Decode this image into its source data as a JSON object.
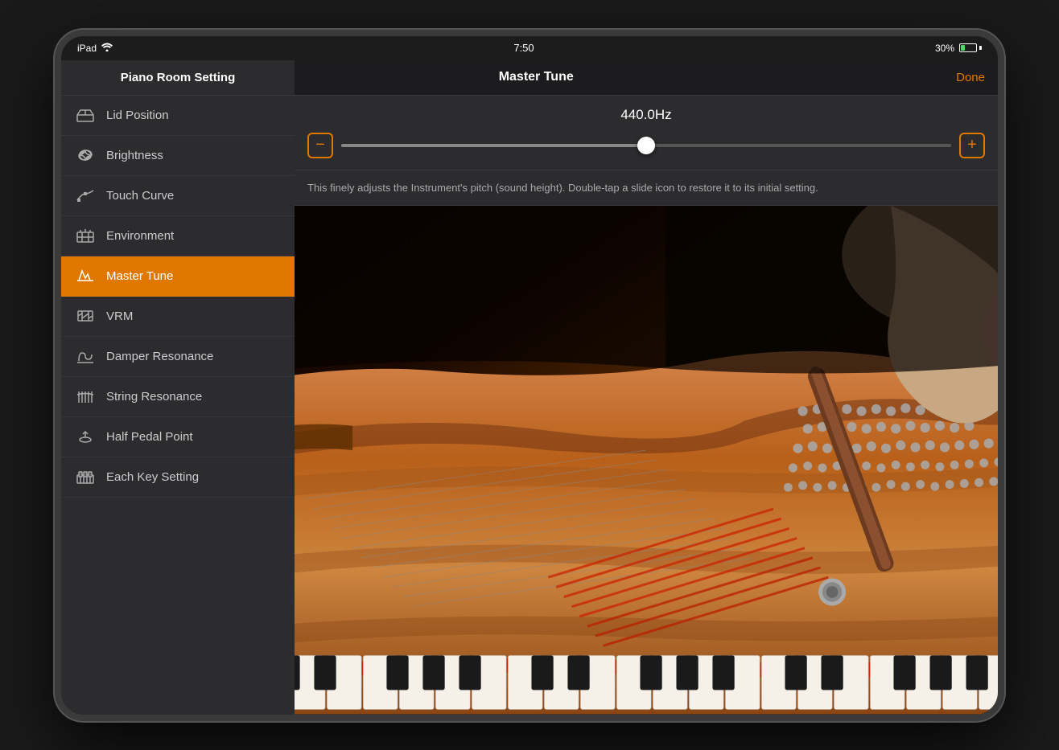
{
  "device": {
    "status_bar": {
      "left": "iPad",
      "time": "7:50",
      "battery": "30%",
      "wifi": true
    }
  },
  "sidebar": {
    "title": "Piano Room Setting",
    "items": [
      {
        "id": "lid-position",
        "label": "Lid Position",
        "icon": "lid",
        "active": false
      },
      {
        "id": "brightness",
        "label": "Brightness",
        "icon": "brightness",
        "active": false
      },
      {
        "id": "touch-curve",
        "label": "Touch Curve",
        "icon": "touch",
        "active": false
      },
      {
        "id": "environment",
        "label": "Environment",
        "icon": "env",
        "active": false
      },
      {
        "id": "master-tune",
        "label": "Master Tune",
        "icon": "tune",
        "active": true
      },
      {
        "id": "vrm",
        "label": "VRM",
        "icon": "vrm",
        "active": false
      },
      {
        "id": "damper-resonance",
        "label": "Damper Resonance",
        "icon": "damper",
        "active": false
      },
      {
        "id": "string-resonance",
        "label": "String Resonance",
        "icon": "string",
        "active": false
      },
      {
        "id": "half-pedal",
        "label": "Half Pedal Point",
        "icon": "pedal",
        "active": false
      },
      {
        "id": "each-key",
        "label": "Each Key Setting",
        "icon": "key",
        "active": false
      }
    ]
  },
  "main": {
    "title": "Master Tune",
    "done_label": "Done",
    "tune_value": "440.0Hz",
    "description": "This finely adjusts the Instrument's pitch (sound height). Double-tap a slide icon to restore it to its initial setting.",
    "slider_min_icon": "−",
    "slider_max_icon": "+"
  }
}
